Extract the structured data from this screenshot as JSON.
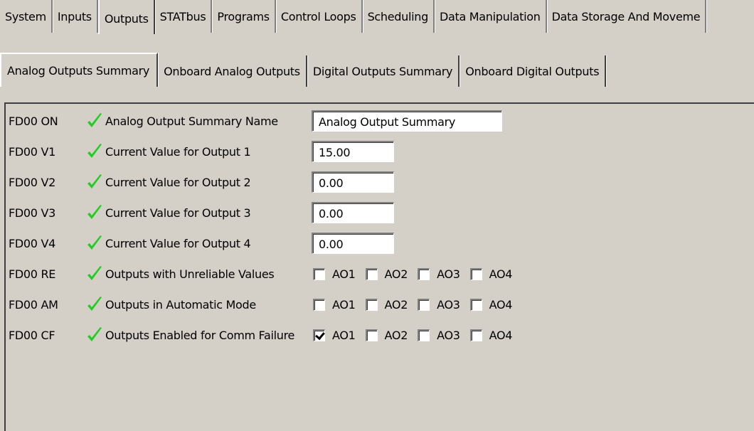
{
  "top_tabs": [
    {
      "label": "System",
      "active": false
    },
    {
      "label": "Inputs",
      "active": false
    },
    {
      "label": "Outputs",
      "active": true
    },
    {
      "label": "STATbus",
      "active": false
    },
    {
      "label": "Programs",
      "active": false
    },
    {
      "label": "Control Loops",
      "active": false
    },
    {
      "label": "Scheduling",
      "active": false
    },
    {
      "label": "Data Manipulation",
      "active": false
    },
    {
      "label": "Data Storage And Moveme",
      "active": false
    }
  ],
  "sub_tabs": [
    {
      "label": "Analog Outputs Summary",
      "active": true
    },
    {
      "label": "Onboard Analog Outputs",
      "active": false
    },
    {
      "label": "Digital Outputs Summary",
      "active": false
    },
    {
      "label": "Onboard Digital Outputs",
      "active": false
    }
  ],
  "status_icon": "green-check-icon",
  "check_color": "#22cc22",
  "rows": [
    {
      "code": "FD00 ON",
      "label": "Analog Output Summary Name",
      "type": "text",
      "value": "Analog Output Summary"
    },
    {
      "code": "FD00 V1",
      "label": "Current Value for Output 1",
      "type": "text",
      "value": "15.00"
    },
    {
      "code": "FD00 V2",
      "label": "Current Value for Output 2",
      "type": "text",
      "value": "0.00"
    },
    {
      "code": "FD00 V3",
      "label": "Current Value for Output 3",
      "type": "text",
      "value": "0.00"
    },
    {
      "code": "FD00 V4",
      "label": "Current Value for Output 4",
      "type": "text",
      "value": "0.00"
    },
    {
      "code": "FD00 RE",
      "label": "Outputs with Unreliable Values",
      "type": "checkboxes",
      "options": [
        {
          "label": "AO1",
          "checked": false
        },
        {
          "label": "AO2",
          "checked": false
        },
        {
          "label": "AO3",
          "checked": false
        },
        {
          "label": "AO4",
          "checked": false
        }
      ]
    },
    {
      "code": "FD00 AM",
      "label": "Outputs in Automatic Mode",
      "type": "checkboxes",
      "options": [
        {
          "label": "AO1",
          "checked": false
        },
        {
          "label": "AO2",
          "checked": false
        },
        {
          "label": "AO3",
          "checked": false
        },
        {
          "label": "AO4",
          "checked": false
        }
      ]
    },
    {
      "code": "FD00 CF",
      "label": "Outputs Enabled for Comm Failure",
      "type": "checkboxes",
      "options": [
        {
          "label": "AO1",
          "checked": true
        },
        {
          "label": "AO2",
          "checked": false
        },
        {
          "label": "AO3",
          "checked": false
        },
        {
          "label": "AO4",
          "checked": false
        }
      ]
    }
  ]
}
